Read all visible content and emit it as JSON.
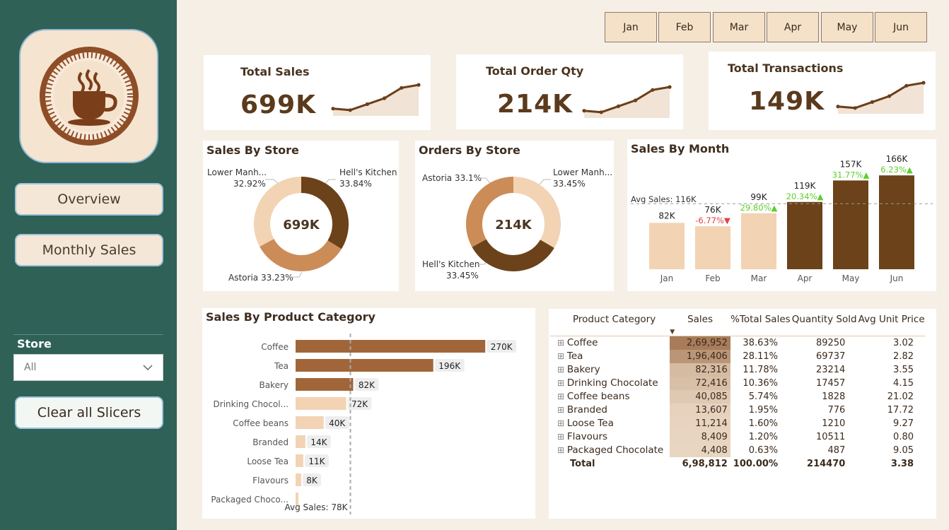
{
  "sidebar": {
    "nav": [
      "Overview",
      "Monthly Sales"
    ],
    "store_label": "Store",
    "store_value": "All",
    "clear_label": "Clear all Slicers"
  },
  "months": [
    "Jan",
    "Feb",
    "Mar",
    "Apr",
    "May",
    "Jun"
  ],
  "kpis": [
    {
      "title": "Total Sales",
      "value": "699K",
      "trend": [
        0.15,
        0.1,
        0.3,
        0.5,
        0.85,
        0.95
      ]
    },
    {
      "title": "Total Order Qty",
      "value": "214K",
      "trend": [
        0.15,
        0.1,
        0.3,
        0.5,
        0.85,
        0.95
      ]
    },
    {
      "title": "Total Transactions",
      "value": "149K",
      "trend": [
        0.15,
        0.1,
        0.3,
        0.5,
        0.85,
        0.95
      ]
    }
  ],
  "colors": {
    "dark": "#6b4219",
    "mid": "#cc8c58",
    "light": "#f2d3b3",
    "sidebar": "#2f6157",
    "bar_mid": "#a0663a",
    "positive": "#5ecf2a",
    "negative": "#e04040"
  },
  "sales_by_store": {
    "title": "Sales By Store",
    "center": "699K",
    "slices": [
      {
        "name": "Hell's Kitchen",
        "pct": 33.84,
        "label": "Hell's Kitchen",
        "pct_label": "33.84%",
        "color": "#6b4219"
      },
      {
        "name": "Astoria",
        "pct": 33.23,
        "label": "Astoria 33.23%",
        "pct_label": "",
        "color": "#cc8c58"
      },
      {
        "name": "Lower Manhattan",
        "pct": 32.92,
        "label": "Lower Manh...",
        "pct_label": "32.92%",
        "color": "#f2d3b3"
      }
    ]
  },
  "orders_by_store": {
    "title": "Orders By Store",
    "center": "214K",
    "slices": [
      {
        "name": "Lower Manhattan",
        "pct": 33.45,
        "label": "Lower Manh...",
        "pct_label": "33.45%",
        "color": "#f2d3b3"
      },
      {
        "name": "Hell's Kitchen",
        "pct": 33.45,
        "label": "Hell's Kitchen",
        "pct_label": "33.45%",
        "color": "#6b4219"
      },
      {
        "name": "Astoria",
        "pct": 33.1,
        "label": "Astoria 33.1%",
        "pct_label": "",
        "color": "#cc8c58"
      }
    ]
  },
  "chart_data": [
    {
      "type": "bar",
      "title": "Sales By Month",
      "categories": [
        "Jan",
        "Feb",
        "Mar",
        "Apr",
        "May",
        "Jun"
      ],
      "values": [
        82,
        76,
        99,
        119,
        157,
        166
      ],
      "value_labels": [
        "82K",
        "76K",
        "99K",
        "119K",
        "157K",
        "166K"
      ],
      "change_labels": [
        "",
        "-6.77%▼",
        "29.80%▲",
        "20.34%▲",
        "31.77%▲",
        "6.23%▲"
      ],
      "change_colors": [
        "",
        "negative",
        "positive",
        "positive",
        "positive",
        "positive"
      ],
      "bar_styles": [
        "light",
        "light",
        "light",
        "dark",
        "dark",
        "dark"
      ],
      "reference": {
        "label": "Avg Sales: 116K",
        "value": 116
      },
      "ylim": [
        0,
        170
      ],
      "legend": "none"
    },
    {
      "type": "bar",
      "orientation": "horizontal",
      "title": "Sales By Product Category",
      "categories": [
        "Coffee",
        "Tea",
        "Bakery",
        "Drinking Chocol...",
        "Coffee beans",
        "Branded",
        "Loose Tea",
        "Flavours",
        "Packaged Choco..."
      ],
      "values": [
        270,
        196,
        82,
        72,
        40,
        14,
        11,
        8,
        4
      ],
      "value_labels": [
        "270K",
        "196K",
        "82K",
        "72K",
        "40K",
        "14K",
        "11K",
        "8K",
        ""
      ],
      "bar_styles": [
        "bar_mid",
        "bar_mid",
        "bar_mid",
        "light",
        "light",
        "light",
        "light",
        "light",
        "light"
      ],
      "reference": {
        "label": "Avg Sales: 78K",
        "value": 78
      },
      "xlim": [
        0,
        300
      ],
      "legend": "none"
    }
  ],
  "table": {
    "headers": [
      "Product Category",
      "Sales",
      "%Total Sales",
      "Quantity Sold",
      "Avg Unit Price"
    ],
    "sort_indicator": "▼",
    "rows": [
      {
        "cat": "Coffee",
        "sales": "2,69,952",
        "sales_val": 269952,
        "pct": "38.63%",
        "qty": "89250",
        "price": "3.02"
      },
      {
        "cat": "Tea",
        "sales": "1,96,406",
        "sales_val": 196406,
        "pct": "28.11%",
        "qty": "69737",
        "price": "2.82"
      },
      {
        "cat": "Bakery",
        "sales": "82,316",
        "sales_val": 82316,
        "pct": "11.78%",
        "qty": "23214",
        "price": "3.55"
      },
      {
        "cat": "Drinking Chocolate",
        "sales": "72,416",
        "sales_val": 72416,
        "pct": "10.36%",
        "qty": "17457",
        "price": "4.15"
      },
      {
        "cat": "Coffee beans",
        "sales": "40,085",
        "sales_val": 40085,
        "pct": "5.74%",
        "qty": "1828",
        "price": "21.02"
      },
      {
        "cat": "Branded",
        "sales": "13,607",
        "sales_val": 13607,
        "pct": "1.95%",
        "qty": "776",
        "price": "17.72"
      },
      {
        "cat": "Loose Tea",
        "sales": "11,214",
        "sales_val": 11214,
        "pct": "1.60%",
        "qty": "1210",
        "price": "9.27"
      },
      {
        "cat": "Flavours",
        "sales": "8,409",
        "sales_val": 8409,
        "pct": "1.20%",
        "qty": "10511",
        "price": "0.80"
      },
      {
        "cat": "Packaged Chocolate",
        "sales": "4,408",
        "sales_val": 4408,
        "pct": "0.63%",
        "qty": "487",
        "price": "9.05"
      }
    ],
    "total": {
      "cat": "Total",
      "sales": "6,98,812",
      "pct": "100.00%",
      "qty": "214470",
      "price": "3.38"
    },
    "expand_icon": "⊞"
  }
}
